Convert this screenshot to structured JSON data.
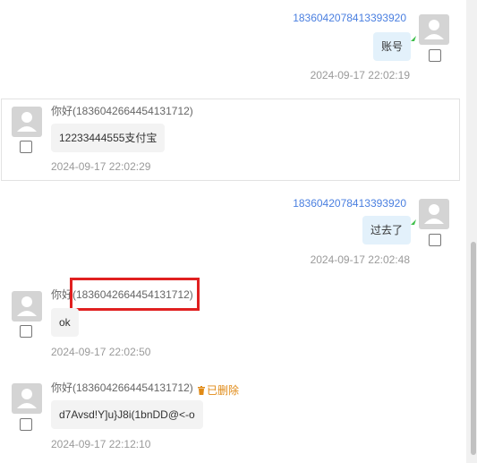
{
  "colors": {
    "self_name": "#4a7fe0",
    "self_bubble": "#e3f1fb",
    "other_bubble": "#f3f3f3",
    "timestamp": "#9a9a9a",
    "highlight": "#e02020",
    "deleted": "#e08a16",
    "tail": "#3fbf4b"
  },
  "messages": [
    {
      "side": "self",
      "sender": "1836042078413393920",
      "text": "账号",
      "time": "2024-09-17 22:02:19"
    },
    {
      "side": "other",
      "sender": "你好(1836042664454131712)",
      "text": "12233444555支付宝",
      "time": "2024-09-17 22:02:29"
    },
    {
      "side": "self",
      "sender": "1836042078413393920",
      "text": "过去了",
      "time": "2024-09-17 22:02:48"
    },
    {
      "side": "other",
      "sender": "你好(1836042664454131712)",
      "text": "ok",
      "time": "2024-09-17 22:02:50"
    },
    {
      "side": "other",
      "sender": "你好(1836042664454131712)",
      "text": "d7Avsd!Y]u}J8i(1bnDD@<-o",
      "time": "2024-09-17 22:12:10",
      "status": "已删除",
      "status_icon": "trash-icon"
    }
  ]
}
